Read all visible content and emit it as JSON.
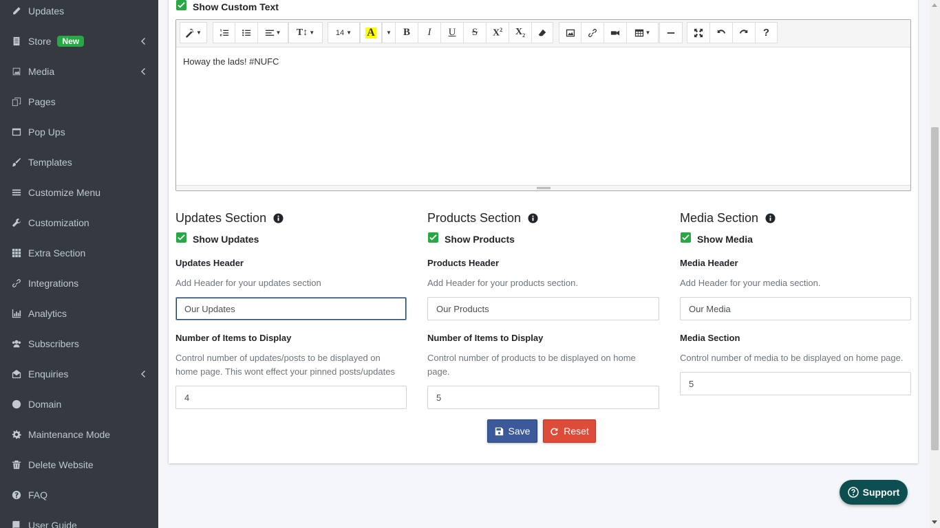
{
  "sidebar": {
    "items": [
      {
        "label": "Updates",
        "icon": "pencil-icon"
      },
      {
        "label": "Store",
        "icon": "store-icon",
        "badge": "New",
        "chevron": true
      },
      {
        "label": "Media",
        "icon": "image-icon",
        "chevron": true
      },
      {
        "label": "Pages",
        "icon": "copy-icon"
      },
      {
        "label": "Pop Ups",
        "icon": "window-icon"
      },
      {
        "label": "Templates",
        "icon": "paintbrush-icon"
      },
      {
        "label": "Customize Menu",
        "icon": "bars-icon"
      },
      {
        "label": "Customization",
        "icon": "wrench-icon"
      },
      {
        "label": "Extra Section",
        "icon": "grid-icon"
      },
      {
        "label": "Integrations",
        "icon": "link-icon"
      },
      {
        "label": "Analytics",
        "icon": "chart-icon"
      },
      {
        "label": "Subscribers",
        "icon": "users-icon"
      },
      {
        "label": "Enquiries",
        "icon": "envelope-icon",
        "chevron": true
      },
      {
        "label": "Domain",
        "icon": "globe-icon"
      },
      {
        "label": "Maintenance Mode",
        "icon": "gear-icon"
      },
      {
        "label": "Delete Website",
        "icon": "trash-icon"
      },
      {
        "label": "FAQ",
        "icon": "question-icon"
      },
      {
        "label": "User Guide",
        "icon": "book-icon"
      }
    ]
  },
  "custom_text": {
    "checkbox_label": "Show Custom Text",
    "checked": true,
    "content": "Howay the lads! #NUFC",
    "font_size": "14"
  },
  "sections": {
    "updates": {
      "title": "Updates Section",
      "show_label": "Show Updates",
      "header_label": "Updates Header",
      "header_help": "Add Header for your updates section",
      "header_value": "Our Updates",
      "count_label": "Number of Items to Display",
      "count_help_1": "Control number of updates/posts to be displayed on",
      "count_help_2": "home page. This wont effect your pinned posts/updates",
      "count_value": "4"
    },
    "products": {
      "title": "Products Section",
      "show_label": "Show Products",
      "header_label": "Products Header",
      "header_help": "Add Header for your products section.",
      "header_value": "Our Products",
      "count_label": "Number of Items to Display",
      "count_help_1": "Control number of products to be displayed on home",
      "count_help_2": "page.",
      "count_value": "5"
    },
    "media": {
      "title": "Media Section",
      "show_label": "Show Media",
      "header_label": "Media Header",
      "header_help": "Add Header for your media section.",
      "header_value": "Our Media",
      "count_label": "Media Section",
      "count_help_1": "Control number of media to be displayed on home page.",
      "count_value": "5"
    }
  },
  "actions": {
    "save_label": "Save",
    "reset_label": "Reset"
  },
  "support_label": "Support",
  "colors": {
    "sidebar_bg": "#343a40",
    "accent_green": "#28a745",
    "save_blue": "#3c5a9a",
    "reset_red": "#dd4b39",
    "support_teal": "#0d4f50"
  }
}
